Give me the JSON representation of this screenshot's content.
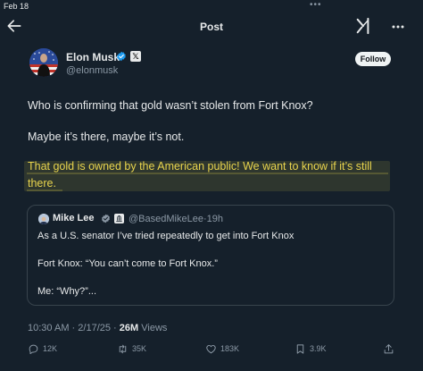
{
  "status_bar": {
    "date": "Feb 18",
    "dots": "•••"
  },
  "header": {
    "title": "Post"
  },
  "author": {
    "name": "Elon Musk",
    "handle": "@elonmusk",
    "follow_label": "Follow",
    "affiliate_badge": "𝕏"
  },
  "tweet": {
    "lines": [
      "Who is confirming that gold wasn’t stolen from Fort Knox?",
      "Maybe it’s there, maybe it’s not.",
      "That gold is owned by the American public! We want to know if it’s still there."
    ]
  },
  "quote": {
    "name": "Mike Lee",
    "handle": "@BasedMikeLee",
    "separator": "·",
    "age": "19h",
    "lines": [
      "As a U.S. senator I’ve tried repeatedly to get into Fort Knox",
      "Fort Knox: “You can’t come to Fort Knox.”",
      "Me: “Why?”..."
    ]
  },
  "meta": {
    "time": "10:30 AM",
    "date": "2/17/25",
    "separator": "·",
    "views_count": "26M",
    "views_label": "Views"
  },
  "actions": {
    "replies": "12K",
    "reposts": "35K",
    "likes": "183K",
    "bookmarks": "3.9K"
  },
  "colors": {
    "background": "#15202b",
    "highlight": "#e8d44d",
    "verified": "#1d9bf0",
    "muted": "#8b98a5"
  }
}
